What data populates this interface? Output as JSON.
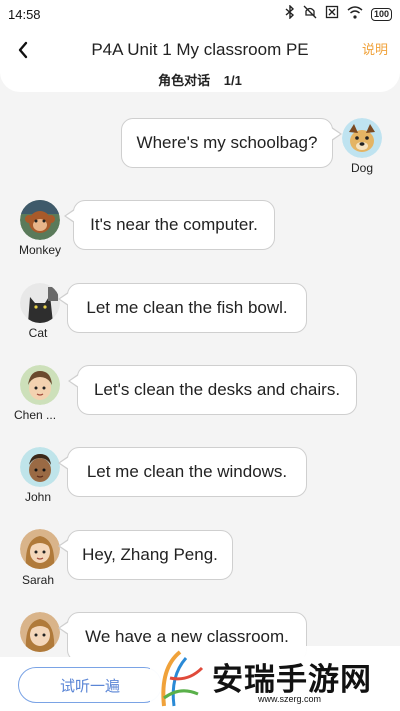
{
  "status_bar": {
    "time": "14:58",
    "icons": [
      "bluetooth-icon",
      "mute-icon",
      "sim-icon",
      "wifi-icon"
    ],
    "battery": "100"
  },
  "header": {
    "title": "P4A Unit 1 My classroom PE",
    "subtitle": "角色对话",
    "page": "1/1",
    "help_label": "说明",
    "accent_color": "#f0a23a"
  },
  "messages": [
    {
      "speaker": "Dog",
      "text": "Where's my schoolbag?",
      "side": "right"
    },
    {
      "speaker": "Monkey",
      "text": "It's near the computer.",
      "side": "left"
    },
    {
      "speaker": "Cat",
      "text": "Let me clean the fish bowl.",
      "side": "left"
    },
    {
      "speaker": "Chen ...",
      "text": "Let's clean the desks and chairs.",
      "side": "left"
    },
    {
      "speaker": "John",
      "text": "Let me clean the windows.",
      "side": "left"
    },
    {
      "speaker": "Sarah",
      "text": "Hey, Zhang Peng.",
      "side": "left"
    },
    {
      "speaker": "",
      "text": "We have a new classroom.",
      "side": "left"
    }
  ],
  "bottom": {
    "listen_label": "试听一遍",
    "button_color": "#5b86d6"
  },
  "watermark": {
    "text": "安瑞手游网",
    "url": "www.szerg.com"
  }
}
